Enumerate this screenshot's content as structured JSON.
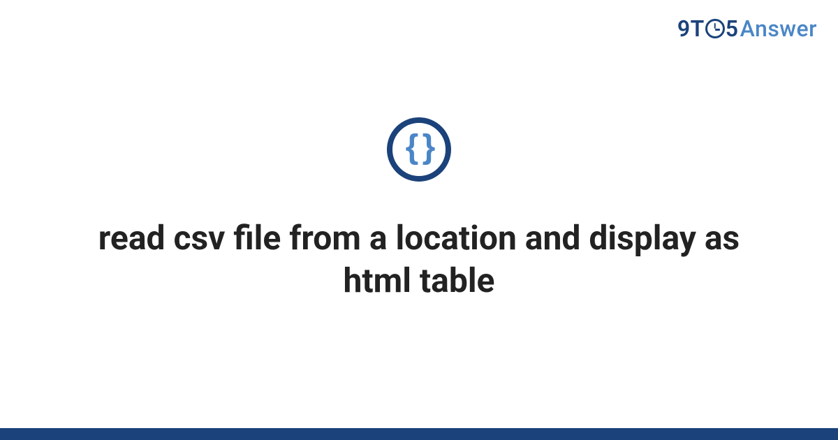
{
  "logo": {
    "part1": "9T",
    "part2": "5",
    "part3": "Answer"
  },
  "icon": {
    "glyph": "{ }"
  },
  "title": "read csv file from a location and display as html table"
}
